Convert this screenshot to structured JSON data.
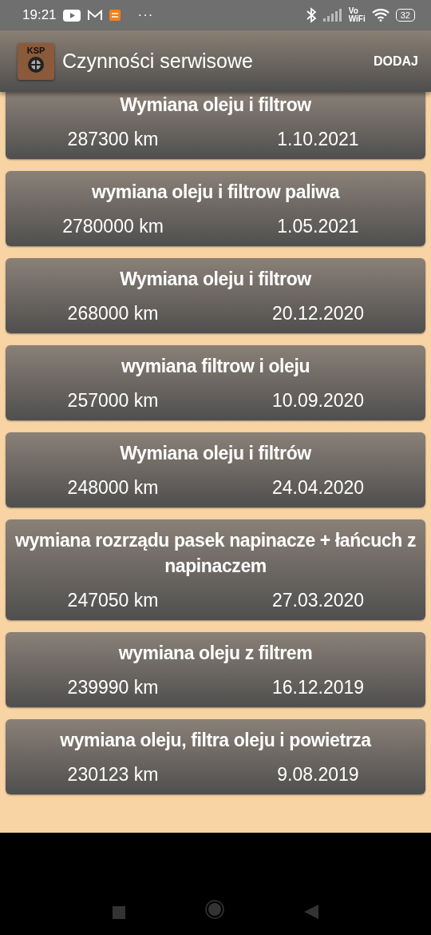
{
  "status_bar": {
    "time": "19:21",
    "more": "···",
    "volte_top": "Vo",
    "volte_bottom": "WiFi",
    "battery": "32"
  },
  "app_bar": {
    "logo_text": "KSP",
    "title": "Czynności serwisowe",
    "action": "DODAJ"
  },
  "records": [
    {
      "title": "Wymiana oleju i filtrow",
      "mileage": "287300 km",
      "date": "1.10.2021"
    },
    {
      "title": "wymiana oleju i filtrow paliwa",
      "mileage": "2780000 km",
      "date": "1.05.2021"
    },
    {
      "title": "Wymiana oleju i filtrow",
      "mileage": "268000 km",
      "date": "20.12.2020"
    },
    {
      "title": "wymiana filtrow i oleju",
      "mileage": "257000 km",
      "date": "10.09.2020"
    },
    {
      "title": "Wymiana oleju i filtrów",
      "mileage": "248000 km",
      "date": "24.04.2020"
    },
    {
      "title": "wymiana rozrządu pasek napinacze + łańcuch z napinaczem",
      "mileage": "247050 km",
      "date": "27.03.2020"
    },
    {
      "title": "wymiana oleju z filtrem",
      "mileage": "239990 km",
      "date": "16.12.2019"
    },
    {
      "title": "wymiana oleju, filtra oleju i powietrza",
      "mileage": "230123 km",
      "date": "9.08.2019"
    }
  ]
}
